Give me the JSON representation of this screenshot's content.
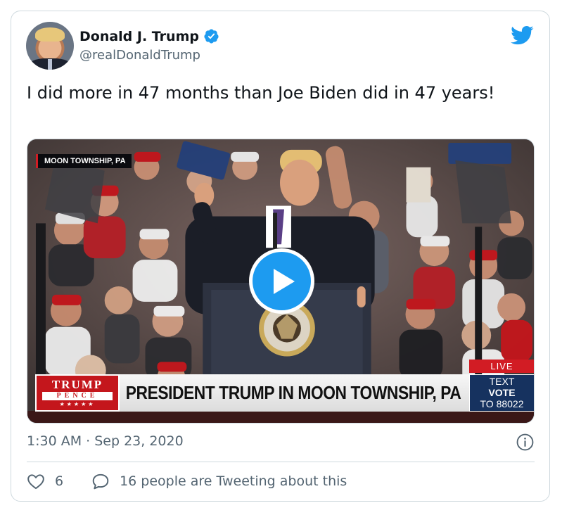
{
  "author": {
    "name": "Donald J. Trump",
    "handle": "@realDonaldTrump",
    "verified_icon": "verified-badge-icon",
    "avatar": "profile-photo"
  },
  "brand": {
    "icon": "twitter-bird-icon",
    "color": "#1d9bf0"
  },
  "tweet": {
    "text": "I did more in 47 months than Joe Biden did in 47 years!"
  },
  "video": {
    "location_tag": "MOON TOWNSHIP, PA",
    "logo_line1": "TRUMP",
    "logo_line2": "PENCE",
    "logo_stars": "★★★★★",
    "headline": "PRESIDENT TRUMP IN MOON TOWNSHIP, PA",
    "live_label": "LIVE",
    "vote_line1": "TEXT",
    "vote_line2": "VOTE",
    "vote_line3": "TO 88022",
    "play_icon": "play-icon"
  },
  "meta": {
    "timestamp": "1:30 AM · Sep 23, 2020",
    "info_icon": "info-icon"
  },
  "actions": {
    "like_count": "6",
    "reply_text": "16 people are Tweeting about this"
  },
  "colors": {
    "text_primary": "#0f1419",
    "text_secondary": "#536471",
    "border": "#cfd9de",
    "accent": "#1d9bf0"
  }
}
